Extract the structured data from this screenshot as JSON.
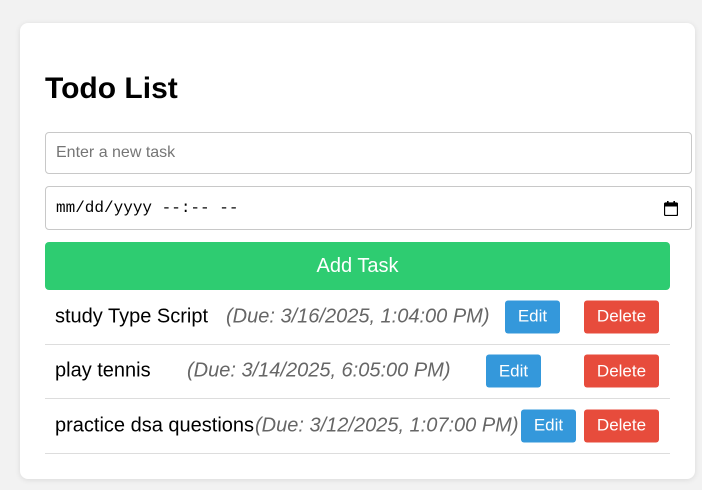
{
  "app": {
    "title": "Todo List"
  },
  "form": {
    "task_placeholder": "Enter a new task",
    "task_value": "",
    "date_placeholder": "mm/dd/yyyy --:-- --",
    "add_label": "Add Task"
  },
  "tasks": [
    {
      "name": "study Type Script",
      "due": "(Due: 3/16/2025, 1:04:00 PM)",
      "edit_label": "Edit",
      "delete_label": "Delete"
    },
    {
      "name": "play tennis",
      "due": "(Due: 3/14/2025, 6:05:00 PM)",
      "edit_label": "Edit",
      "delete_label": "Delete"
    },
    {
      "name": "practice dsa questions",
      "due": "(Due: 3/12/2025, 1:07:00 PM)",
      "edit_label": "Edit",
      "delete_label": "Delete"
    }
  ],
  "colors": {
    "add_button": "#2ecc71",
    "edit_button": "#3498db",
    "delete_button": "#e74c3c",
    "due_text": "#666666"
  }
}
